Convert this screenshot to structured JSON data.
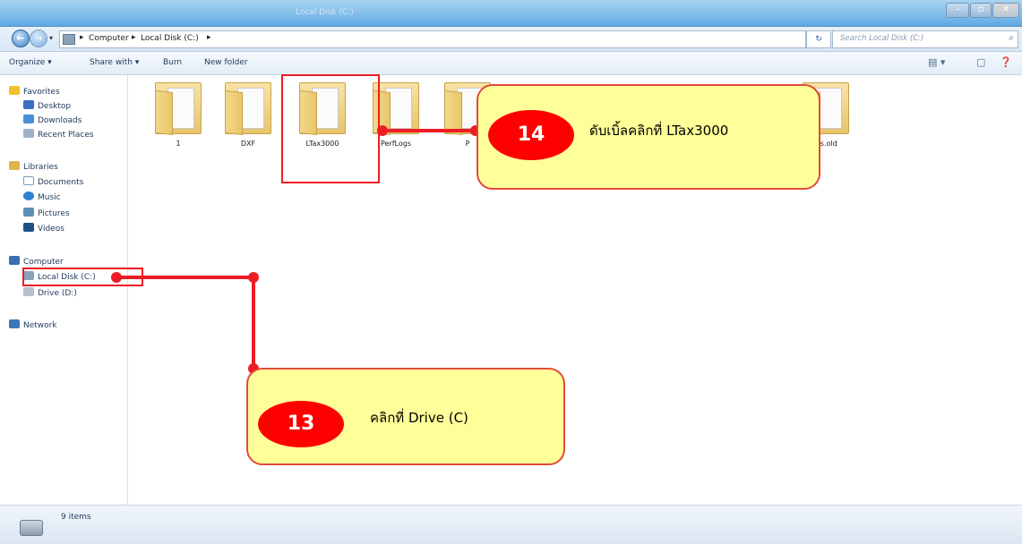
{
  "window": {
    "title": "Local Disk (C:)"
  },
  "address": {
    "crumbs": [
      "Computer",
      "Local Disk (C:)"
    ],
    "separator": "▸",
    "refresh_icon": "↻",
    "search_placeholder": "Search Local Disk (C:)",
    "search_icon": "⌕"
  },
  "toolbar": {
    "organize": "Organize ▾",
    "share_with": "Share with ▾",
    "burn": "Burn",
    "new_folder": "New folder"
  },
  "nav": {
    "favorites": "Favorites",
    "desktop": "Desktop",
    "downloads": "Downloads",
    "recent_places": "Recent Places",
    "libraries": "Libraries",
    "documents": "Documents",
    "music": "Music",
    "pictures": "Pictures",
    "videos": "Videos",
    "computer": "Computer",
    "local_disk": "Local Disk (C:)",
    "drive_d": "Drive (D:)",
    "network": "Network"
  },
  "folders": [
    "1",
    "DXF",
    "LTax3000",
    "PerfLogs",
    "P",
    "",
    "",
    "",
    "ws.old"
  ],
  "status": {
    "items": "9 items"
  },
  "annotations": {
    "step13": {
      "number": "13",
      "text": "คลิกที่  Drive (C)"
    },
    "step14": {
      "number": "14",
      "text": "ดับเบิ้ลคลิกที่  LTax3000"
    }
  },
  "colors": {
    "highlight": "#ee1c24",
    "callout_fill": "#ffff99",
    "badge": "#ff0000"
  }
}
